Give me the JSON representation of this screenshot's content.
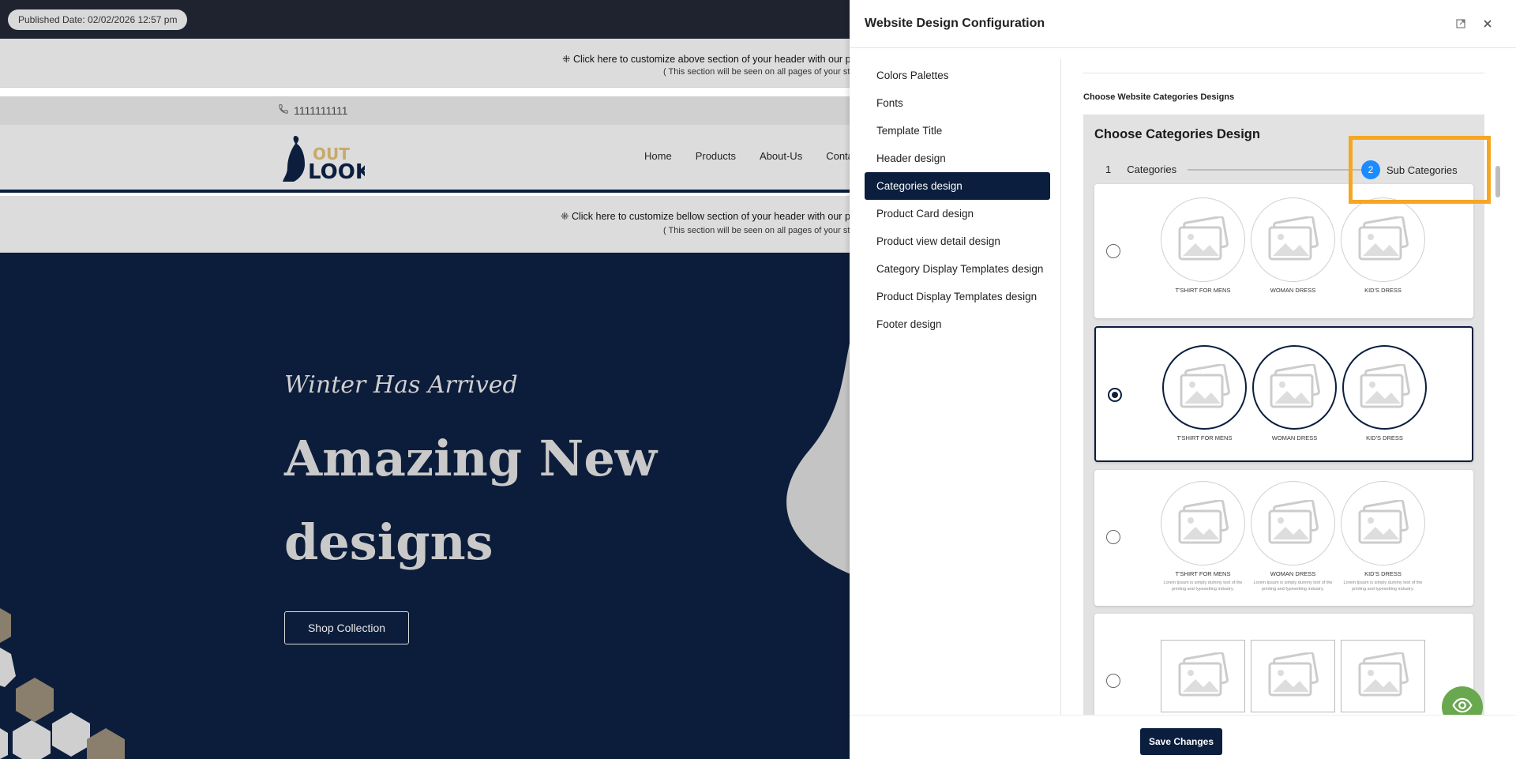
{
  "preview": {
    "published": "Published Date: 02/02/2026 12:57 pm",
    "top_customize": {
      "line1": "⁜ Click here to customize above section of your header with our po",
      "line2": "( This section will be seen on all pages of your store"
    },
    "phone": "1111111111",
    "logo": {
      "line1": "OUT",
      "line2": "LOOK"
    },
    "nav": [
      "Home",
      "Products",
      "About-Us",
      "Conta"
    ],
    "bottom_customize": {
      "line1": "⁜ Click here to customize bellow section of your header with our po",
      "line2": "( This section will be seen on all pages of your store"
    },
    "hero": {
      "script": "Winter Has Arrived",
      "heading": "Amazing New designs",
      "cta": "Shop Collection"
    }
  },
  "panel": {
    "title": "Website Design Configuration",
    "menu": [
      "Colors Palettes",
      "Fonts",
      "Template Title",
      "Header design",
      "Categories design",
      "Product Card design",
      "Product view detail design",
      "Category Display Templates design",
      "Product Display Templates design",
      "Footer design"
    ],
    "active_menu": "Categories design",
    "section_label": "Choose Website Categories Designs",
    "card_title": "Choose Categories Design",
    "steps": [
      {
        "num": "1",
        "label": "Categories"
      },
      {
        "num": "2",
        "label": "Sub Categories"
      }
    ],
    "thumb_labels": [
      "T'SHIRT FOR MENS",
      "WOMAN DRESS",
      "KID'S DRESS"
    ],
    "thumb_desc": "Lorem Ipsum is simply dummy text of the printing and typesetting industry.",
    "selected_design": 2,
    "save": "Save Changes"
  },
  "colors": {
    "navy": "#0b1e3e",
    "accent_blue": "#1a8cff",
    "highlight": "#f5a623",
    "fab": "#6aa84f"
  }
}
